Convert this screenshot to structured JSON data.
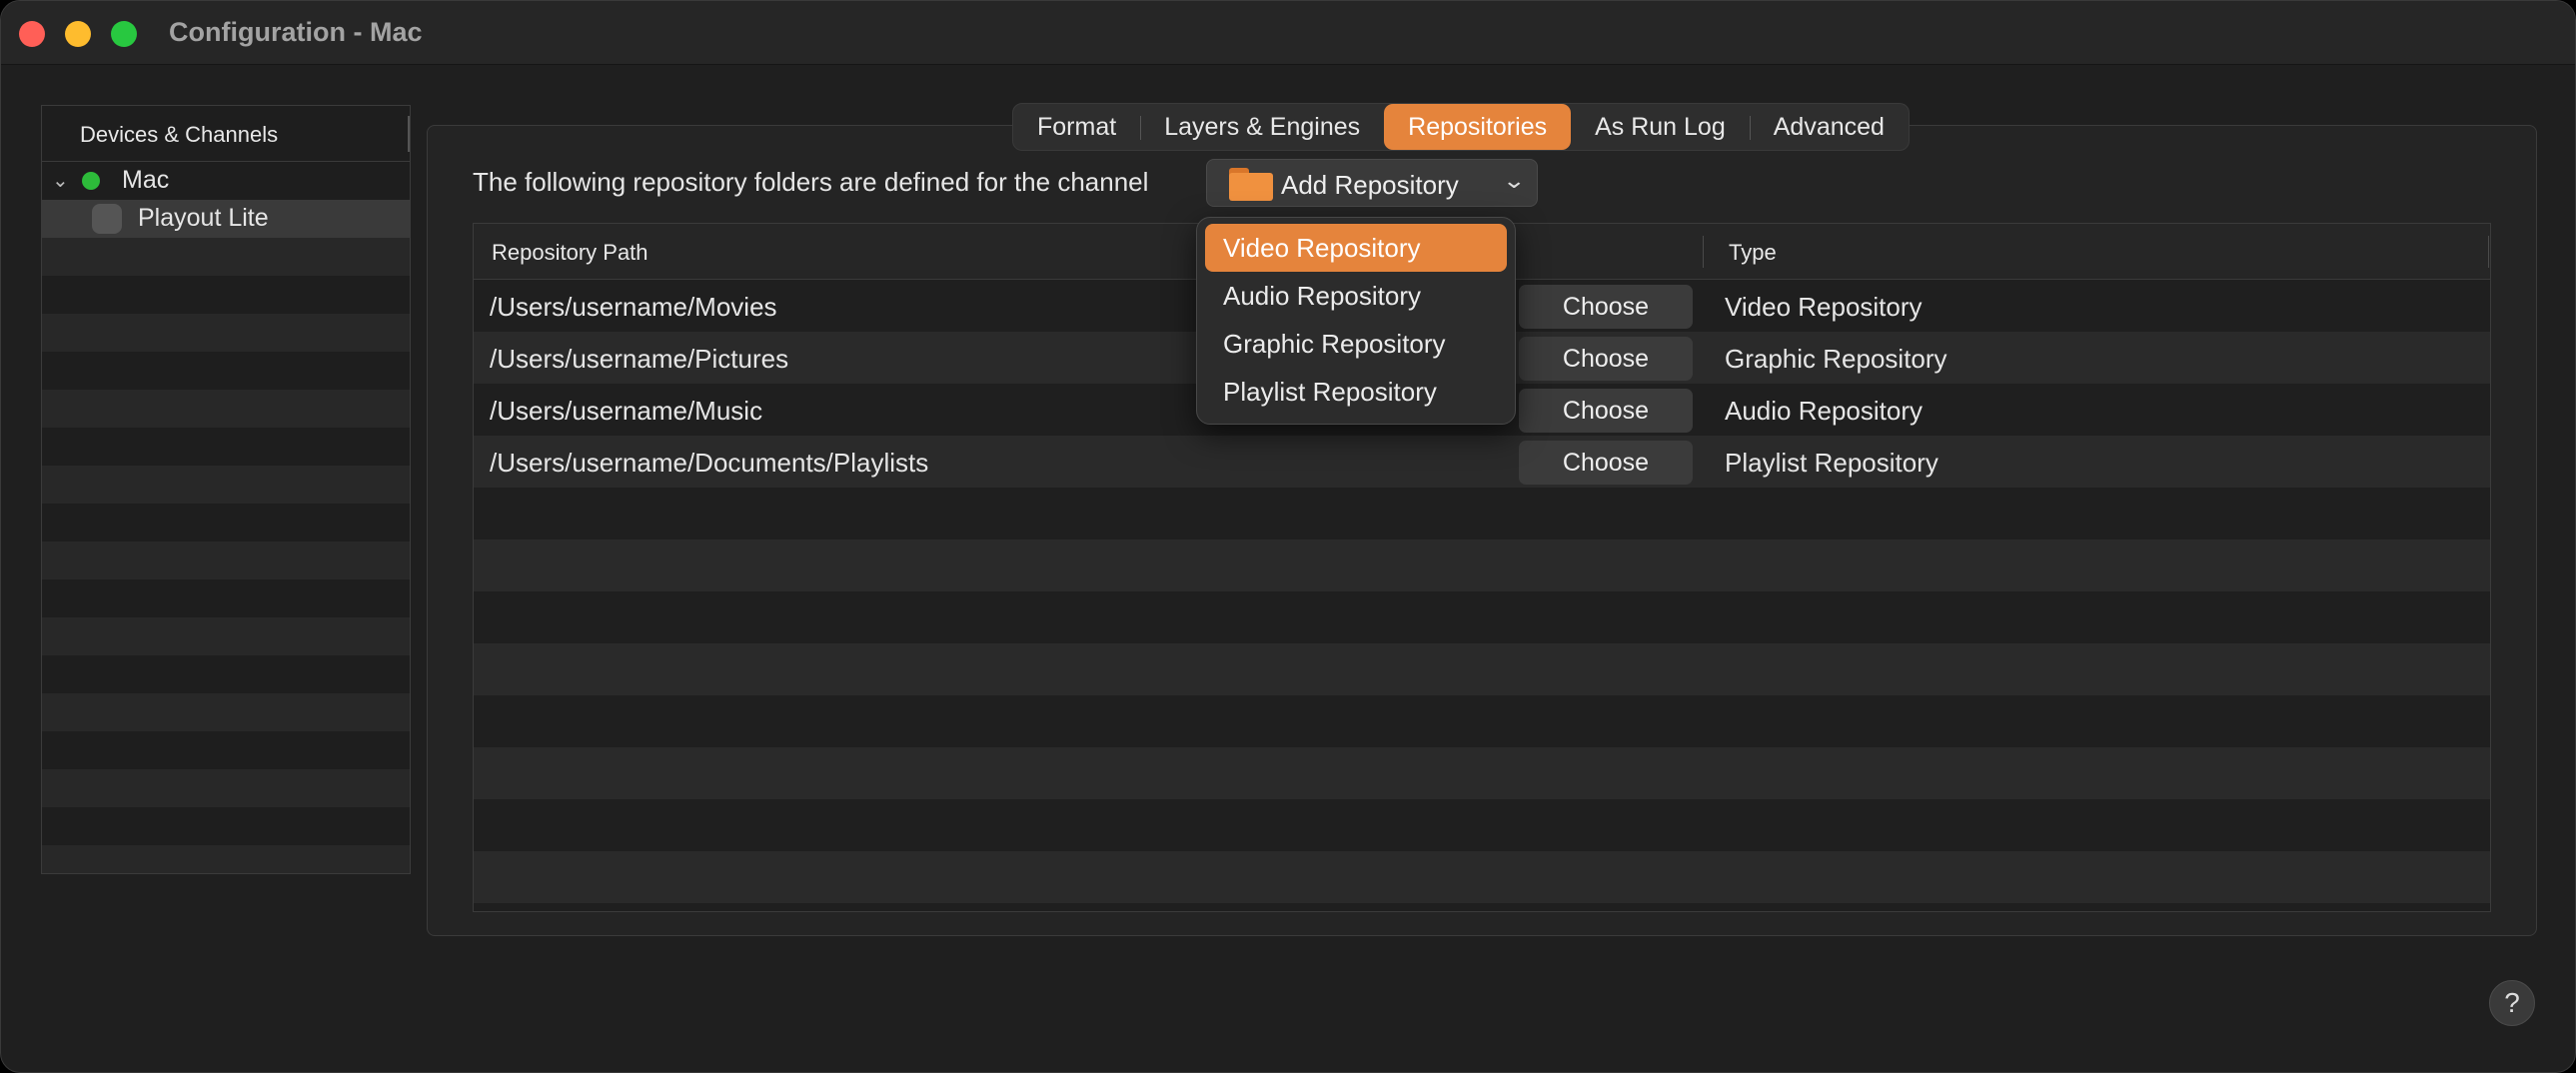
{
  "window": {
    "title": "Configuration - Mac"
  },
  "sidebar": {
    "header": "Devices & Channels",
    "device": {
      "label": "Mac",
      "status_color": "#2dbb3a"
    },
    "channel": {
      "label": "Playout Lite"
    }
  },
  "tabs": [
    {
      "label": "Format",
      "active": false
    },
    {
      "label": "Layers & Engines",
      "active": false
    },
    {
      "label": "Repositories",
      "active": true
    },
    {
      "label": "As Run Log",
      "active": false
    },
    {
      "label": "Advanced",
      "active": false
    }
  ],
  "repositories": {
    "description": "The following repository folders are defined for the channel",
    "add_button_label": "Add Repository",
    "columns": {
      "path": "Repository Path",
      "type": "Type"
    },
    "choose_label": "Choose",
    "rows": [
      {
        "path": "/Users/username/Movies",
        "type": "Video Repository"
      },
      {
        "path": "/Users/username/Pictures",
        "type": "Graphic Repository"
      },
      {
        "path": "/Users/username/Music",
        "type": "Audio Repository"
      },
      {
        "path": "/Users/username/Documents/Playlists",
        "type": "Playlist Repository"
      }
    ]
  },
  "menu": {
    "items": [
      {
        "label": "Video Repository",
        "highlighted": true
      },
      {
        "label": "Audio Repository",
        "highlighted": false
      },
      {
        "label": "Graphic Repository",
        "highlighted": false
      },
      {
        "label": "Playlist Repository",
        "highlighted": false
      }
    ]
  },
  "help_label": "?",
  "colors": {
    "accent": "#e5843c",
    "background": "#1f1f1f"
  }
}
